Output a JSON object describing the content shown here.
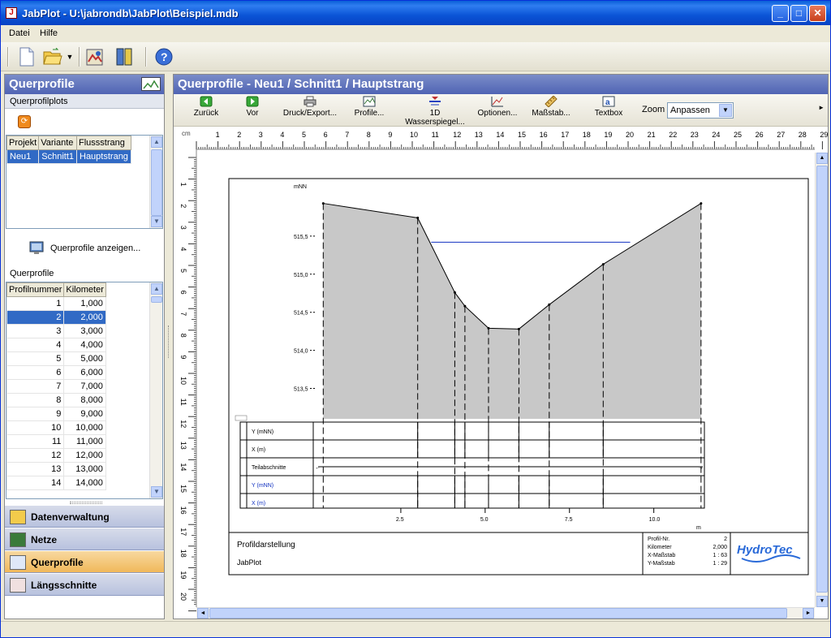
{
  "window": {
    "title": "JabPlot - U:\\jabrondb\\JabPlot\\Beispiel.mdb"
  },
  "menu": {
    "file": "Datei",
    "help": "Hilfe"
  },
  "left": {
    "header": "Querprofile",
    "plots_label": "Querprofilplots",
    "plots_columns": [
      "Projekt",
      "Variante",
      "Flussstrang"
    ],
    "plots_rows": [
      [
        "Neu1",
        "Schnitt1",
        "Hauptstrang"
      ]
    ],
    "show_button": "Querprofile anzeigen...",
    "profiles_label": "Querprofile",
    "profiles_columns": [
      "Profilnummer",
      "Kilometer"
    ],
    "profiles_rows": [
      [
        "1",
        "1,000"
      ],
      [
        "2",
        "2,000"
      ],
      [
        "3",
        "3,000"
      ],
      [
        "4",
        "4,000"
      ],
      [
        "5",
        "5,000"
      ],
      [
        "6",
        "6,000"
      ],
      [
        "7",
        "7,000"
      ],
      [
        "8",
        "8,000"
      ],
      [
        "9",
        "9,000"
      ],
      [
        "10",
        "10,000"
      ],
      [
        "11",
        "11,000"
      ],
      [
        "12",
        "12,000"
      ],
      [
        "13",
        "13,000"
      ],
      [
        "14",
        "14,000"
      ]
    ],
    "selected_profile": "2",
    "nav": [
      "Datenverwaltung",
      "Netze",
      "Querprofile",
      "Längsschnitte"
    ],
    "nav_active": "Querprofile"
  },
  "right": {
    "header": "Querprofile - Neu1 / Schnitt1 / Hauptstrang",
    "toolbar": [
      "Zurück",
      "Vor",
      "Druck/Export...",
      "Profile...",
      "1D Wasserspiegel...",
      "Optionen...",
      "Maßstab...",
      "Textbox"
    ],
    "zoom_label": "Zoom",
    "zoom_value": "Anpassen",
    "ruler_unit": "cm"
  },
  "plot": {
    "y_unit": "mNN",
    "x_unit": "m",
    "y_ticks": [
      "515,5",
      "515,0",
      "514,5",
      "514,0",
      "513,5"
    ],
    "x_ticks": [
      "2.5",
      "5.0",
      "7.5",
      "10.0"
    ],
    "table_rows": [
      "Y (mNN)",
      "X (m)",
      "Teilabschnitte",
      "Y (mNN)",
      "X (m)"
    ],
    "footer_title": "Profildarstellung",
    "footer_sub": "JabPlot",
    "info_labels": [
      "Profil-Nr.",
      "Kilometer",
      "X-Maßstab",
      "Y-Maßstab"
    ],
    "info_values": [
      "2",
      "2,000",
      "1 : 63",
      "1 : 29"
    ],
    "logo": "HydroTec"
  },
  "chart_data": {
    "type": "area",
    "x": [
      0.2,
      3.0,
      4.1,
      4.4,
      5.1,
      6.0,
      6.9,
      8.5,
      11.4
    ],
    "y": [
      515.93,
      515.74,
      514.76,
      514.58,
      514.29,
      514.28,
      514.6,
      515.13,
      515.93
    ],
    "water_level": 515.42,
    "water_x": [
      3.4,
      9.3
    ],
    "xlim": [
      0,
      11.5
    ],
    "ylim": [
      513.1,
      516.0
    ]
  }
}
